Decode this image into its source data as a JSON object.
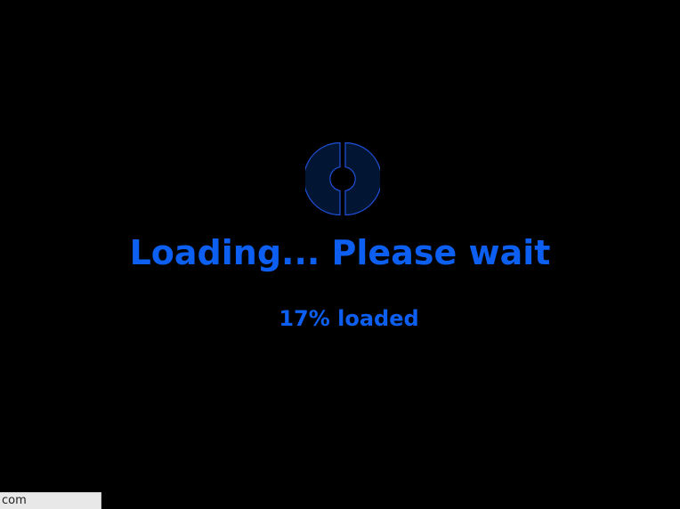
{
  "loading": {
    "title": "Loading... Please wait",
    "progress_text": "17% loaded",
    "progress_fraction": 0.17,
    "spinner_icon": "loading-spinner-icon"
  },
  "status_bar": {
    "text": "com"
  },
  "colors": {
    "background": "#000000",
    "accent": "#0c5ff0",
    "spinner_fill": "#021633",
    "spinner_stroke": "#1f4fd8"
  }
}
